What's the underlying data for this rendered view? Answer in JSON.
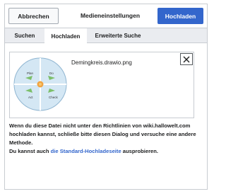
{
  "dialog": {
    "title": "Medieneinstellungen",
    "cancel_label": "Abbrechen",
    "upload_label": "Hochladen",
    "accent_color": "#3366cc"
  },
  "tabs": [
    {
      "label": "Suchen",
      "active": false
    },
    {
      "label": "Hochladen",
      "active": true
    },
    {
      "label": "Erweiterte Suche",
      "active": false
    }
  ],
  "file": {
    "name": "Demingkreis.drawio.png",
    "thumbnail": {
      "quadrants": [
        "Plan",
        "Do",
        "Act",
        "Check"
      ]
    },
    "remove_icon": "close-icon"
  },
  "notice": {
    "text": "Wenn du diese Datei nicht unter den Richtlinien von wiki.hallowelt.com hochladen kannst, schließe bitte diesen Dialog und versuche eine andere Methode."
  },
  "alternative": {
    "prefix": "Du kannst auch ",
    "link_text": "die Standard-Hochladeseite",
    "suffix": " ausprobieren."
  }
}
